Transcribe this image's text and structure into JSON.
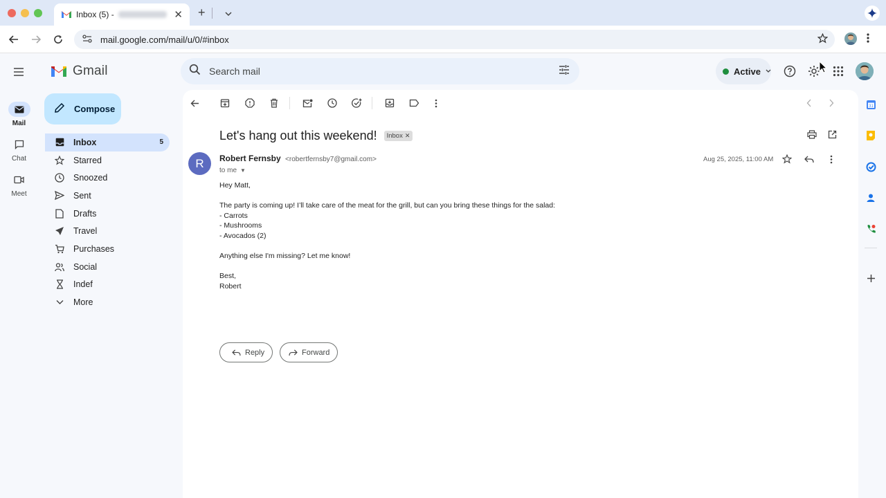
{
  "browser": {
    "tab_title": "Inbox (5) -",
    "url": "mail.google.com/mail/u/0/#inbox",
    "icons": [
      "back-icon",
      "forward-icon",
      "reload-icon",
      "site-info-icon",
      "bookmark-star-icon",
      "profile-avatar",
      "browser-menu-icon",
      "new-tab-icon",
      "tab-list-icon",
      "gemini-icon"
    ]
  },
  "header": {
    "app_name": "Gmail",
    "search_placeholder": "Search mail",
    "status_label": "Active",
    "colors": {
      "search_bg": "#eaf1fb",
      "status_dot": "#1e8e3e"
    }
  },
  "rail": {
    "items": [
      {
        "label": "Mail",
        "icon": "mail-icon",
        "active": true
      },
      {
        "label": "Chat",
        "icon": "chat-icon",
        "active": false
      },
      {
        "label": "Meet",
        "icon": "meet-icon",
        "active": false
      }
    ]
  },
  "sidebar": {
    "compose_label": "Compose",
    "items": [
      {
        "label": "Inbox",
        "count": "5",
        "icon": "inbox-icon"
      },
      {
        "label": "Starred",
        "icon": "star-icon"
      },
      {
        "label": "Snoozed",
        "icon": "clock-icon"
      },
      {
        "label": "Sent",
        "icon": "send-icon"
      },
      {
        "label": "Drafts",
        "icon": "draft-icon"
      },
      {
        "label": "Travel",
        "icon": "plane-icon"
      },
      {
        "label": "Purchases",
        "icon": "cart-icon"
      },
      {
        "label": "Social",
        "icon": "people-icon"
      },
      {
        "label": "Indef",
        "icon": "hourglass-icon"
      },
      {
        "label": "More",
        "icon": "chevron-down-icon"
      }
    ]
  },
  "email": {
    "subject": "Let's hang out this weekend!",
    "label_chip": "Inbox",
    "sender_initial": "R",
    "sender_name": "Robert Fernsby",
    "sender_email": "<robertfernsby7@gmail.com>",
    "recipient": "to me",
    "date": "Aug 25, 2025, 11:00 AM",
    "body": [
      "Hey Matt,",
      "",
      "The party is coming up! I’ll take care of the meat for the grill, but can you bring these things for the salad:",
      "- Carrots",
      "- Mushrooms",
      "- Avocados (2)",
      "",
      "Anything else I'm missing? Let me know!",
      "",
      "Best,",
      "Robert"
    ],
    "reply_label": "Reply",
    "forward_label": "Forward"
  }
}
